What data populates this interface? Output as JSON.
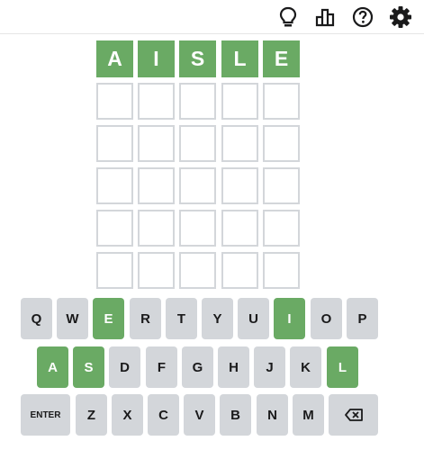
{
  "header": {
    "icons": [
      "lightbulb-icon",
      "stats-icon",
      "help-icon",
      "settings-icon"
    ]
  },
  "board": {
    "rows": [
      {
        "letters": [
          "A",
          "I",
          "S",
          "L",
          "E"
        ],
        "states": [
          "correct",
          "correct",
          "correct",
          "correct",
          "correct"
        ]
      },
      {
        "letters": [
          "",
          "",
          "",
          "",
          ""
        ],
        "states": [
          "empty",
          "empty",
          "empty",
          "empty",
          "empty"
        ]
      },
      {
        "letters": [
          "",
          "",
          "",
          "",
          ""
        ],
        "states": [
          "empty",
          "empty",
          "empty",
          "empty",
          "empty"
        ]
      },
      {
        "letters": [
          "",
          "",
          "",
          "",
          ""
        ],
        "states": [
          "empty",
          "empty",
          "empty",
          "empty",
          "empty"
        ]
      },
      {
        "letters": [
          "",
          "",
          "",
          "",
          ""
        ],
        "states": [
          "empty",
          "empty",
          "empty",
          "empty",
          "empty"
        ]
      },
      {
        "letters": [
          "",
          "",
          "",
          "",
          ""
        ],
        "states": [
          "empty",
          "empty",
          "empty",
          "empty",
          "empty"
        ]
      }
    ]
  },
  "keyboard": {
    "rows": [
      [
        {
          "label": "Q",
          "state": "default"
        },
        {
          "label": "W",
          "state": "default"
        },
        {
          "label": "E",
          "state": "correct"
        },
        {
          "label": "R",
          "state": "default"
        },
        {
          "label": "T",
          "state": "default"
        },
        {
          "label": "Y",
          "state": "default"
        },
        {
          "label": "U",
          "state": "default"
        },
        {
          "label": "I",
          "state": "correct"
        },
        {
          "label": "O",
          "state": "default"
        },
        {
          "label": "P",
          "state": "default"
        }
      ],
      [
        {
          "label": "A",
          "state": "correct"
        },
        {
          "label": "S",
          "state": "correct"
        },
        {
          "label": "D",
          "state": "default"
        },
        {
          "label": "F",
          "state": "default"
        },
        {
          "label": "G",
          "state": "default"
        },
        {
          "label": "H",
          "state": "default"
        },
        {
          "label": "J",
          "state": "default"
        },
        {
          "label": "K",
          "state": "default"
        },
        {
          "label": "L",
          "state": "correct"
        }
      ],
      [
        {
          "label": "ENTER",
          "state": "default"
        },
        {
          "label": "Z",
          "state": "default"
        },
        {
          "label": "X",
          "state": "default"
        },
        {
          "label": "C",
          "state": "default"
        },
        {
          "label": "V",
          "state": "default"
        },
        {
          "label": "B",
          "state": "default"
        },
        {
          "label": "N",
          "state": "default"
        },
        {
          "label": "M",
          "state": "default"
        },
        {
          "label": "",
          "state": "default",
          "icon": "backspace-icon"
        }
      ]
    ]
  },
  "colors": {
    "correct": "#6aaa64",
    "key_default": "#d3d6da",
    "tile_border": "#d3d6da"
  }
}
